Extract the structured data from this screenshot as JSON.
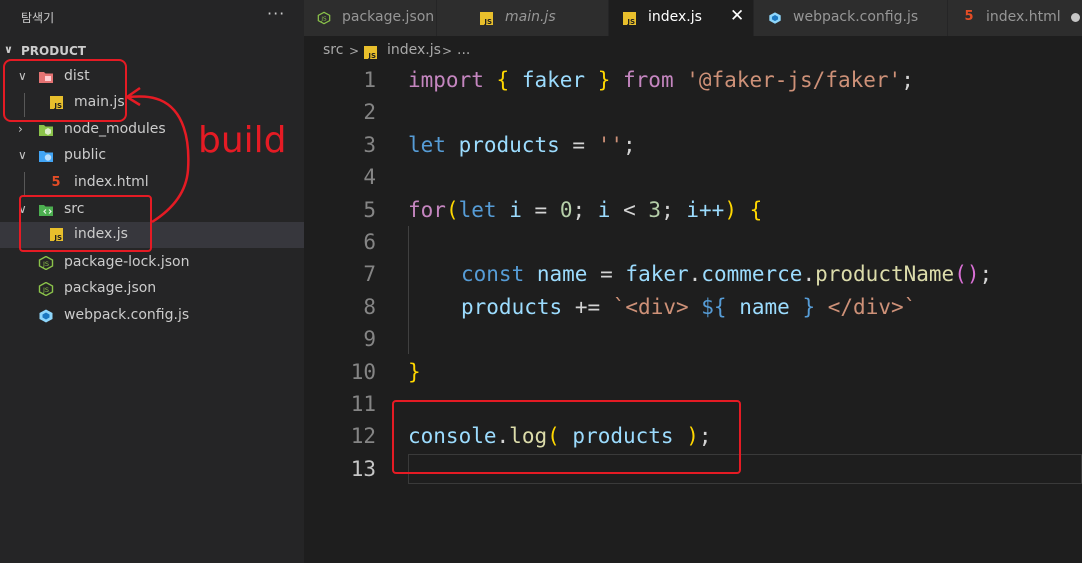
{
  "explorer": {
    "title": "탐색기",
    "more": "···",
    "section": "PRODUCT",
    "tree": [
      {
        "label": "dist",
        "icon": "dist-folder-icon"
      },
      {
        "label": "main.js",
        "icon": "js-file-icon",
        "badge": "JS"
      },
      {
        "label": "node_modules",
        "icon": "node-folder-icon"
      },
      {
        "label": "public",
        "icon": "public-folder-icon"
      },
      {
        "label": "index.html",
        "icon": "html-file-icon",
        "badge": "5"
      },
      {
        "label": "src",
        "icon": "src-folder-icon"
      },
      {
        "label": "index.js",
        "icon": "js-file-icon",
        "badge": "JS"
      },
      {
        "label": "package-lock.json",
        "icon": "json-file-icon",
        "badge": "JS"
      },
      {
        "label": "package.json",
        "icon": "json-file-icon",
        "badge": "JS"
      },
      {
        "label": "webpack.config.js",
        "icon": "webpack-icon"
      }
    ]
  },
  "tabs": [
    {
      "label": "package.json",
      "icon": "json-file-icon"
    },
    {
      "label": "main.js",
      "icon": "js-file-icon"
    },
    {
      "label": "index.js",
      "icon": "js-file-icon",
      "active": true,
      "close": "✕"
    },
    {
      "label": "webpack.config.js",
      "icon": "webpack-icon"
    },
    {
      "label": "index.html",
      "icon": "html-file-icon"
    }
  ],
  "breadcrumb": {
    "folder": "src",
    "sep1": ">",
    "file": "index.js",
    "sep2": ">",
    "more": "..."
  },
  "code": {
    "line_numbers": [
      "1",
      "2",
      "3",
      "4",
      "5",
      "6",
      "7",
      "8",
      "9",
      "10",
      "11",
      "12",
      "13"
    ],
    "l1": {
      "import": "import",
      "b_open": "{",
      "faker": "faker",
      "b_close": "}",
      "from": "from",
      "module": "'@faker-js/faker'",
      "semi": ";"
    },
    "l3": {
      "let": "let",
      "products": "products",
      "eq": "=",
      "str": "''",
      "semi": ";"
    },
    "l5": {
      "for": "for",
      "p_open": "(",
      "let": "let",
      "i": "i",
      "eq": "=",
      "zero": "0",
      "semi1": ";",
      "i2": "i",
      "lt": "<",
      "three": "3",
      "semi2": ";",
      "i3": "i++",
      "p_close": ")",
      "b_open": "{"
    },
    "l7": {
      "const": "const",
      "name": "name",
      "eq": "=",
      "faker": "faker",
      "dot1": ".",
      "commerce": "commerce",
      "dot2": ".",
      "fn": "productName",
      "parens": "()",
      "semi": ";"
    },
    "l8": {
      "products": "products",
      "op": "+=",
      "t1": "`<div> ",
      "d_open": "${",
      "name": "name",
      "d_close": "}",
      "t2": " </div>`"
    },
    "l10": {
      "b_close": "}"
    },
    "l12": {
      "console": "console",
      "dot": ".",
      "log": "log",
      "p_open": "(",
      "products": "products",
      "p_close": ")",
      "semi": ";"
    }
  },
  "annotation": {
    "build_label": "build",
    "color": "#e51b24"
  },
  "colors": {
    "accent": "#e51b24",
    "js_icon": "#e8bf2c",
    "html_icon": "#e44d26",
    "json_icon": "#8bc34a"
  }
}
